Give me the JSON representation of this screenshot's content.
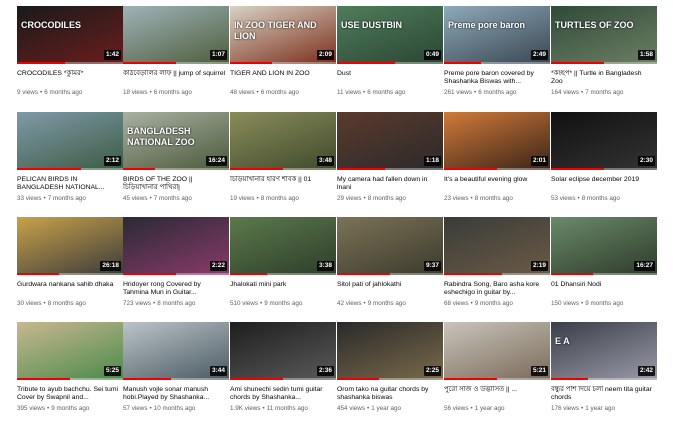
{
  "videos": [
    {
      "title": "CROCODILES *কুমির*",
      "views": "9 views",
      "age": "6 months ago",
      "duration": "1:42",
      "overlay": "CROCODILES",
      "colors": [
        "#1a1a1a",
        "#6b1d1d"
      ],
      "progress": 0.45
    },
    {
      "title": "কাঠবেড়ালির লাফ || jump of squirrel",
      "views": "18 views",
      "age": "6 months ago",
      "duration": "1:07",
      "overlay": "",
      "colors": [
        "#9fb3b8",
        "#4e5d3c"
      ],
      "progress": 0.5
    },
    {
      "title": "TIGER AND LION IN ZOO",
      "views": "48 views",
      "age": "6 months ago",
      "duration": "2:09",
      "overlay": "IN ZOO TIGER AND LION",
      "colors": [
        "#d8d2c4",
        "#7b2e1a"
      ],
      "progress": 0.4
    },
    {
      "title": "Dust",
      "views": "11 views",
      "age": "6 months ago",
      "duration": "0:49",
      "overlay": "USE DUSTBIN",
      "colors": [
        "#4f7d5c",
        "#2b4533"
      ],
      "progress": 0.55
    },
    {
      "title": "Preme pore baron covered by Shashanka Biswas with...",
      "views": "261 views",
      "age": "6 months ago",
      "duration": "2:49",
      "overlay": "Preme pore baron",
      "colors": [
        "#8ea9b8",
        "#3a4652"
      ],
      "progress": 0.35
    },
    {
      "title": "*কচ্ছপ* || Turtle in Bangladesh Zoo",
      "views": "164 views",
      "age": "7 months ago",
      "duration": "1:58",
      "overlay": "TURTLES OF ZOO",
      "colors": [
        "#2f4a3a",
        "#6d7f63"
      ],
      "progress": 0.5
    },
    {
      "title": "PELICAN BIRDS IN BANGLADESH NATIONAL...",
      "views": "33 views",
      "age": "7 months ago",
      "duration": "2:12",
      "overlay": "",
      "colors": [
        "#7f9aa8",
        "#3b5c44"
      ],
      "progress": 0.6
    },
    {
      "title": "BIRDS OF THE ZOO || চিড়িয়াখানার পাখিরা|",
      "views": "45 views",
      "age": "7 months ago",
      "duration": "16:24",
      "overlay": "BANGLADESH NATIONAL ZOO",
      "colors": [
        "#a9b0a2",
        "#4a5a3a"
      ],
      "progress": 0.3
    },
    {
      "title": "চিড়িয়াখানার হারণ শাবক || 01",
      "views": "19 views",
      "age": "8 months ago",
      "duration": "3:48",
      "overlay": "",
      "colors": [
        "#8a8c5a",
        "#3f4a2c"
      ],
      "progress": 0.5
    },
    {
      "title": "My camera had fallen down in lnani",
      "views": "29 views",
      "age": "8 months ago",
      "duration": "1:18",
      "overlay": "",
      "colors": [
        "#5a3a2e",
        "#2c2a2a"
      ],
      "progress": 0.45
    },
    {
      "title": "It's a beautiful evening glow",
      "views": "23 views",
      "age": "8 months ago",
      "duration": "2:01",
      "overlay": "",
      "colors": [
        "#d07a3a",
        "#3a2418"
      ],
      "progress": 0.5
    },
    {
      "title": "Solar eclipse december 2019",
      "views": "53 views",
      "age": "8 months ago",
      "duration": "2:30",
      "overlay": "",
      "colors": [
        "#111111",
        "#333333"
      ],
      "progress": 0.5
    },
    {
      "title": "Gurdwara nankana sahib dhaka",
      "views": "30 views",
      "age": "8 months ago",
      "duration": "26:18",
      "overlay": "",
      "colors": [
        "#c9a24a",
        "#3b3b3b"
      ],
      "progress": 0.4
    },
    {
      "title": "Hridoyer rong Covered by Tahmina Mun in Guitar...",
      "views": "723 views",
      "age": "8 months ago",
      "duration": "2:22",
      "overlay": "",
      "colors": [
        "#2a2a35",
        "#8a3a6a"
      ],
      "progress": 0.5
    },
    {
      "title": "Jhalokati mini park",
      "views": "510 views",
      "age": "9 months ago",
      "duration": "3:38",
      "overlay": "",
      "colors": [
        "#5b7a4c",
        "#2e3d2a"
      ],
      "progress": 0.35
    },
    {
      "title": "Sitol pati of jahlokathi",
      "views": "42 views",
      "age": "9 months ago",
      "duration": "9:37",
      "overlay": "",
      "colors": [
        "#7b7358",
        "#3c3a2c"
      ],
      "progress": 0.5
    },
    {
      "title": "Rabindra Song, Baro asha kore eshechigo in guitar by...",
      "views": "68 views",
      "age": "9 months ago",
      "duration": "2:19",
      "overlay": "",
      "colors": [
        "#3a3c3a",
        "#6b5a45"
      ],
      "progress": 0.55
    },
    {
      "title": "01 Dhansiri Nodi",
      "views": "150 views",
      "age": "9 months ago",
      "duration": "16:27",
      "overlay": "",
      "colors": [
        "#6a8a6a",
        "#2e3a2a"
      ],
      "progress": 0.4
    },
    {
      "title": "Tribute to ayub bachchu. Sei tumi Cover by Swapnil and...",
      "views": "395 views",
      "age": "9 months ago",
      "duration": "5:25",
      "overlay": "",
      "colors": [
        "#c8b890",
        "#4a8a4a"
      ],
      "progress": 0.5
    },
    {
      "title": "Manush vojle sonar manush hobi.Played by Shashanka...",
      "views": "57 views",
      "age": "10 months ago",
      "duration": "3:44",
      "overlay": "",
      "colors": [
        "#bcc4c8",
        "#4a5a62"
      ],
      "progress": 0.45
    },
    {
      "title": "Ami shunechi sedin tumi guitar chords by Shashanka...",
      "views": "1.9K views",
      "age": "11 months ago",
      "duration": "2:36",
      "overlay": "",
      "colors": [
        "#1e1e1e",
        "#5a5a5a"
      ],
      "progress": 0.5
    },
    {
      "title": "Orom tako na guitar chords by shashanka biswas",
      "views": "454 views",
      "age": "1 year ago",
      "duration": "2:25",
      "overlay": "",
      "colors": [
        "#2a2a2a",
        "#7a6a4a"
      ],
      "progress": 0.4
    },
    {
      "title": "পুরো সাজ ও উদ্ভাসিত || ...",
      "views": "56 views",
      "age": "1 year ago",
      "duration": "5:21",
      "overlay": "",
      "colors": [
        "#c8c4bc",
        "#7a6a58"
      ],
      "progress": 0.5
    },
    {
      "title": "বন্ধুর পাশ দিয়ে চলা neem tita guitar chords",
      "views": "176 views",
      "age": "1 year ago",
      "duration": "2:42",
      "overlay": "E A",
      "colors": [
        "#3a3e48",
        "#9a9aa8"
      ],
      "progress": 0.35
    }
  ]
}
